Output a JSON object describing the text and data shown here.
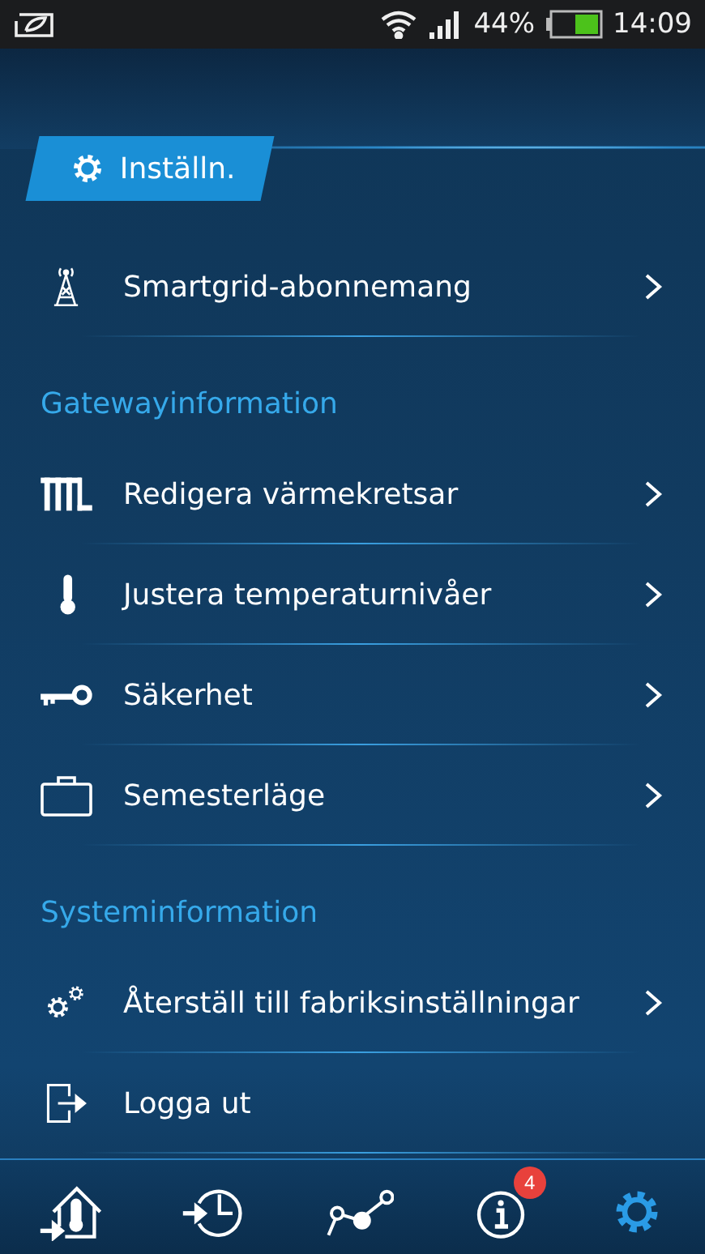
{
  "status_bar": {
    "battery": "44%",
    "time": "14:09"
  },
  "header_badge": {
    "label": "Inställn."
  },
  "sections": [
    {
      "items": [
        {
          "label": "Smartgrid-abonnemang",
          "chevron": true
        }
      ]
    },
    {
      "title": "Gatewayinformation",
      "items": [
        {
          "label": "Redigera värmekretsar",
          "chevron": true
        },
        {
          "label": "Justera temperaturnivåer",
          "chevron": true
        },
        {
          "label": "Säkerhet",
          "chevron": true
        },
        {
          "label": "Semesterläge",
          "chevron": true
        }
      ]
    },
    {
      "title": "Systeminformation",
      "items": [
        {
          "label": "Återställ till fabriksinställningar",
          "chevron": true
        },
        {
          "label": "Logga ut",
          "chevron": false
        }
      ]
    }
  ],
  "nav": [
    {
      "selected": false
    },
    {
      "selected": false
    },
    {
      "selected": false
    },
    {
      "selected": false,
      "badge": "4"
    },
    {
      "selected": true
    }
  ]
}
